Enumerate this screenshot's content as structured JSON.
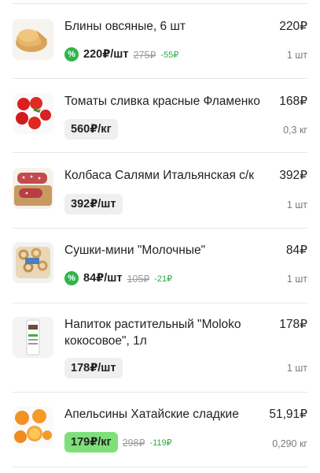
{
  "items": [
    {
      "name": "Блины овсяные, 6 шт",
      "total": "220₽",
      "qty": "1 шт",
      "price": "220₽/шт",
      "old_price": "275₽",
      "diff": "-55₽",
      "discount_icon": "%"
    },
    {
      "name": "Томаты сливка красные Фламенко",
      "total": "168₽",
      "qty": "0,3 кг",
      "price": "560₽/кг"
    },
    {
      "name": "Колбаса Салями Итальянская с/к",
      "total": "392₽",
      "qty": "1 шт",
      "price": "392₽/шт"
    },
    {
      "name": "Сушки-мини \"Молочные\"",
      "total": "84₽",
      "qty": "1 шт",
      "price": "84₽/шт",
      "old_price": "105₽",
      "diff": "-21₽",
      "discount_icon": "%"
    },
    {
      "name": "Напиток растительный \"Moloko кокосовое\", 1л",
      "total": "178₽",
      "qty": "1 шт",
      "price": "178₽/шт"
    },
    {
      "name": "Апельсины Хатайские сладкие",
      "total": "51,91₽",
      "qty": "0,290 кг",
      "price": "179₽/кг",
      "old_price": "298₽",
      "diff": "-119₽"
    }
  ],
  "colors": {
    "discount_green": "#32b34a",
    "highlight_green": "#7fe07a",
    "pill_gray": "#efefef"
  }
}
